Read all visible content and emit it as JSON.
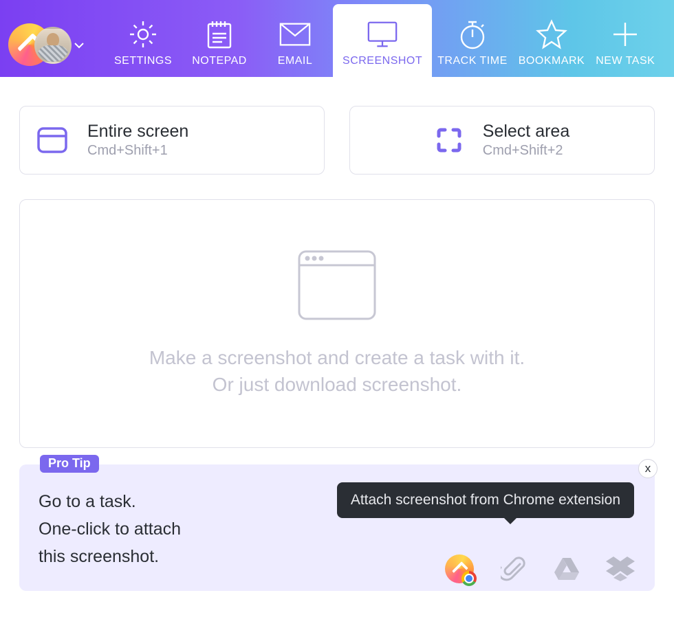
{
  "header": {
    "tabs": [
      {
        "label": "SETTINGS"
      },
      {
        "label": "NOTEPAD"
      },
      {
        "label": "EMAIL"
      },
      {
        "label": "SCREENSHOT"
      },
      {
        "label": "TRACK TIME"
      },
      {
        "label": "BOOKMARK"
      },
      {
        "label": "NEW TASK"
      }
    ]
  },
  "capture": {
    "entire": {
      "title": "Entire screen",
      "shortcut": "Cmd+Shift+1"
    },
    "select": {
      "title": "Select area",
      "shortcut": "Cmd+Shift+2"
    }
  },
  "dropzone": {
    "line1": "Make a screenshot and create a task with it.",
    "line2": "Or just download screenshot."
  },
  "pro": {
    "badge": "Pro Tip",
    "line1": "Go to a task.",
    "line2": "One-click to attach",
    "line3": "this screenshot.",
    "tooltip": "Attach screenshot from Chrome extension",
    "close": "x"
  }
}
